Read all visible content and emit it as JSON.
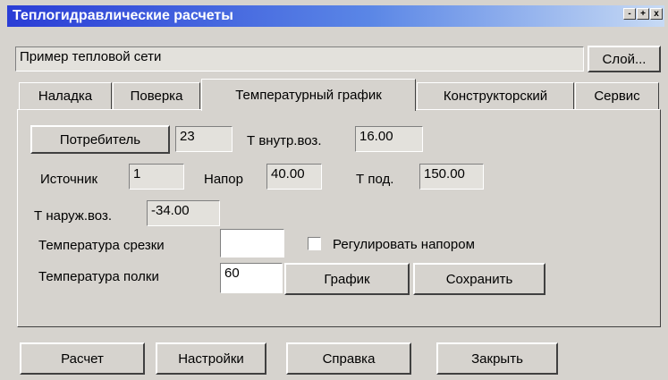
{
  "window": {
    "title": "Теплогидравлические расчеты",
    "min_btn": "-",
    "max_btn": "+",
    "close_btn": "x"
  },
  "network": {
    "name": "Пример тепловой сети",
    "layer_button": "Слой..."
  },
  "tabs": [
    {
      "label": "Наладка",
      "active": false
    },
    {
      "label": "Поверка",
      "active": false
    },
    {
      "label": "Температурный график",
      "active": true
    },
    {
      "label": "Конструкторский",
      "active": false
    },
    {
      "label": "Сервис",
      "active": false
    }
  ],
  "form": {
    "consumer_button": "Потребитель",
    "consumer_value": "23",
    "t_inner_label": "Т внутр.воз.",
    "t_inner_value": "16.00",
    "source_label": "Источник",
    "source_value": "1",
    "pressure_label": "Напор",
    "pressure_value": "40.00",
    "t_supply_label": "Т под.",
    "t_supply_value": "150.00",
    "t_outer_label": "Т наруж.воз.",
    "t_outer_value": "-34.00",
    "cutoff_label": "Температура срезки",
    "cutoff_value": "",
    "regulate_label": "Регулировать напором",
    "regulate_checked": false,
    "shelf_label": "Температура полки",
    "shelf_value": "60",
    "graph_button": "График",
    "save_button": "Сохранить"
  },
  "footer": {
    "calc_button": "Расчет",
    "settings_button": "Настройки",
    "help_button": "Справка",
    "close_button": "Закрыть"
  }
}
